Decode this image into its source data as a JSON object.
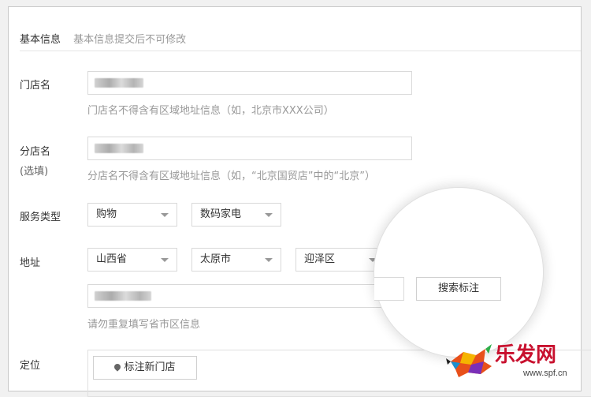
{
  "section": {
    "title": "基本信息",
    "subtitle": "基本信息提交后不可修改"
  },
  "fields": {
    "store_name": {
      "label": "门店名",
      "hint": "门店名不得含有区域地址信息（如，北京市XXX公司）"
    },
    "branch_name": {
      "label": "分店名",
      "optional": "(选填)",
      "hint": "分店名不得含有区域地址信息（如，“北京国贸店”中的“北京”）"
    },
    "service_type": {
      "label": "服务类型",
      "category": "购物",
      "subcategory": "数码家电"
    },
    "address": {
      "label": "地址",
      "province": "山西省",
      "city": "太原市",
      "district": "迎泽区",
      "search_button": "搜索标注",
      "hint": "请勿重复填写省市区信息"
    },
    "location": {
      "label": "定位",
      "mark_button": "标注新门店"
    }
  },
  "watermark": {
    "logo_text": "乐发网",
    "url": "www.spf.cn"
  },
  "colors": {
    "accent": "#c8102e",
    "hint": "#999999",
    "border": "#d9d9d9"
  }
}
